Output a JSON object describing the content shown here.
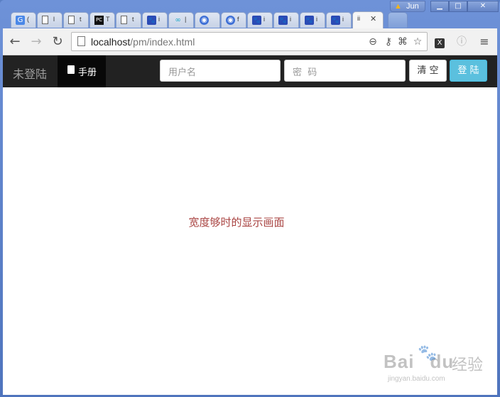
{
  "browser": {
    "user_name": "Jun",
    "tabs": [
      {
        "fav": "G",
        "title": "(",
        "icon": "google-translate-icon"
      },
      {
        "fav": "",
        "title": "l",
        "icon": "page-icon"
      },
      {
        "fav": "",
        "title": "t",
        "icon": "page-icon"
      },
      {
        "fav": "PC",
        "title": "T",
        "icon": "pycharm-icon"
      },
      {
        "fav": "",
        "title": "t",
        "icon": "page-icon"
      },
      {
        "fav": "🐾",
        "title": "i",
        "icon": "baidu-paw-icon"
      },
      {
        "fav": "∞",
        "title": "|",
        "icon": "infinity-icon"
      },
      {
        "fav": "◉",
        "title": "",
        "icon": "rocket-icon"
      },
      {
        "fav": "◉",
        "title": "f",
        "icon": "rocket-icon"
      },
      {
        "fav": "🐾",
        "title": "i",
        "icon": "baidu-paw-icon"
      },
      {
        "fav": "🐾",
        "title": "i",
        "icon": "baidu-paw-icon"
      },
      {
        "fav": "🐾",
        "title": "i",
        "icon": "baidu-paw-icon"
      },
      {
        "fav": "🐾",
        "title": "i",
        "icon": "baidu-paw-icon"
      }
    ],
    "active_tab_title": "ii",
    "url_host": "localhost",
    "url_path": "/pm/index.html"
  },
  "navbar": {
    "brand": "未登陆",
    "manual_label": "手册",
    "username_placeholder": "用户名",
    "password_placeholder": "密  码",
    "clear_label": "清 空",
    "login_label": "登 陆"
  },
  "main": {
    "message": "宽度够时的显示画面"
  },
  "watermark": {
    "logo": "Bai",
    "logo_suffix": "du",
    "jingyan": "经验",
    "site": "jingyan.baidu.com"
  },
  "colors": {
    "navbar_bg": "#222222",
    "info_button": "#5bc0de",
    "message_text": "#a94442"
  }
}
